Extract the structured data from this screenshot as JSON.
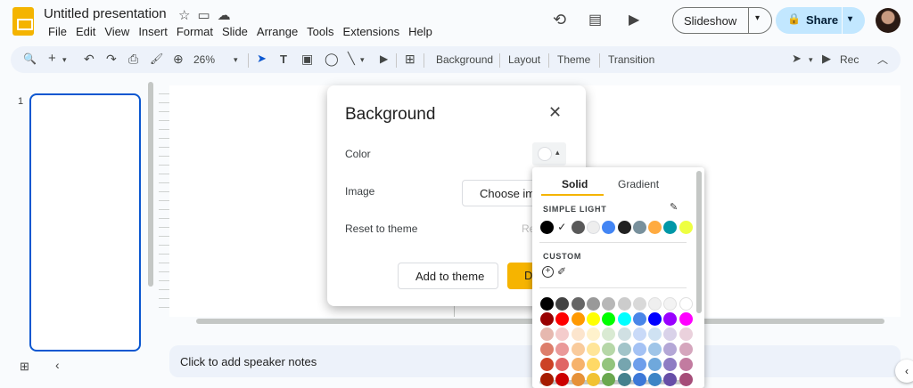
{
  "app": {
    "title": "Untitled presentation",
    "menus": [
      "File",
      "Edit",
      "View",
      "Insert",
      "Format",
      "Slide",
      "Arrange",
      "Tools",
      "Extensions",
      "Help"
    ],
    "slideshow_label": "Slideshow",
    "share_label": "Share"
  },
  "toolbar": {
    "zoom": "26%",
    "background_label": "Background",
    "layout_label": "Layout",
    "theme_label": "Theme",
    "transition_label": "Transition",
    "rec_label": "Rec"
  },
  "filmstrip": {
    "slide_number": "1"
  },
  "notes": {
    "placeholder": "Click to add speaker notes"
  },
  "dialog": {
    "title": "Background",
    "color_label": "Color",
    "image_label": "Image",
    "reset_label": "Reset to theme",
    "choose_image_label": "Choose ima",
    "reset_button_label": "Re",
    "add_to_theme_label": "Add to theme",
    "done_label": "D"
  },
  "picker": {
    "tab_solid": "Solid",
    "tab_gradient": "Gradient",
    "simple_light_label": "SIMPLE LIGHT",
    "custom_label": "CUSTOM",
    "theme_colors": [
      "#000000",
      "#ffffff",
      "#595959",
      "#eeeeee",
      "#4285f4",
      "#212121",
      "#78909c",
      "#ffab40",
      "#0097a7",
      "#eeff41"
    ],
    "selected_theme_index": 1,
    "palette": [
      [
        "#000000",
        "#434343",
        "#666666",
        "#999999",
        "#b7b7b7",
        "#cccccc",
        "#d9d9d9",
        "#efefef",
        "#f3f3f3",
        "#ffffff"
      ],
      [
        "#980000",
        "#ff0000",
        "#ff9900",
        "#ffff00",
        "#00ff00",
        "#00ffff",
        "#4a86e8",
        "#0000ff",
        "#9900ff",
        "#ff00ff"
      ],
      [
        "#e6b8af",
        "#f4cccc",
        "#fce5cd",
        "#fff2cc",
        "#d9ead3",
        "#d0e0e3",
        "#c9daf8",
        "#cfe2f3",
        "#d9d2e9",
        "#ead1dc"
      ],
      [
        "#dd7e6b",
        "#ea9999",
        "#f9cb9c",
        "#ffe599",
        "#b6d7a8",
        "#a2c4c9",
        "#a4c2f4",
        "#9fc5e8",
        "#b4a7d6",
        "#d5a6bd"
      ],
      [
        "#cc4125",
        "#e06666",
        "#f6b26b",
        "#ffd966",
        "#93c47d",
        "#76a5af",
        "#6d9eeb",
        "#6fa8dc",
        "#8e7cc3",
        "#c27ba0"
      ],
      [
        "#a61c00",
        "#cc0000",
        "#e69138",
        "#f1c232",
        "#6aa84f",
        "#45818e",
        "#3c78d8",
        "#3d85c6",
        "#674ea7",
        "#a64d79"
      ]
    ]
  },
  "icons": {
    "star": "☆",
    "folder": "▭",
    "cloud": "☁",
    "history": "⟲",
    "comment": "▤",
    "meet": "▶",
    "lock": "🔒",
    "search": "🔍",
    "plus": "+",
    "undo": "↶",
    "redo": "↷",
    "print": "⎙",
    "paint": "🖌",
    "zoom": "⊕",
    "cursor": "➤",
    "textbox": "T",
    "image": "▣",
    "shape": "◯",
    "line": "╲",
    "comment_add": "⊞",
    "close": "✕",
    "pencil": "✎",
    "dropper": "✐",
    "chevron_up": "︿",
    "chevron_left": "‹",
    "grid": "⊞",
    "check": "✓",
    "caret": "▾"
  }
}
